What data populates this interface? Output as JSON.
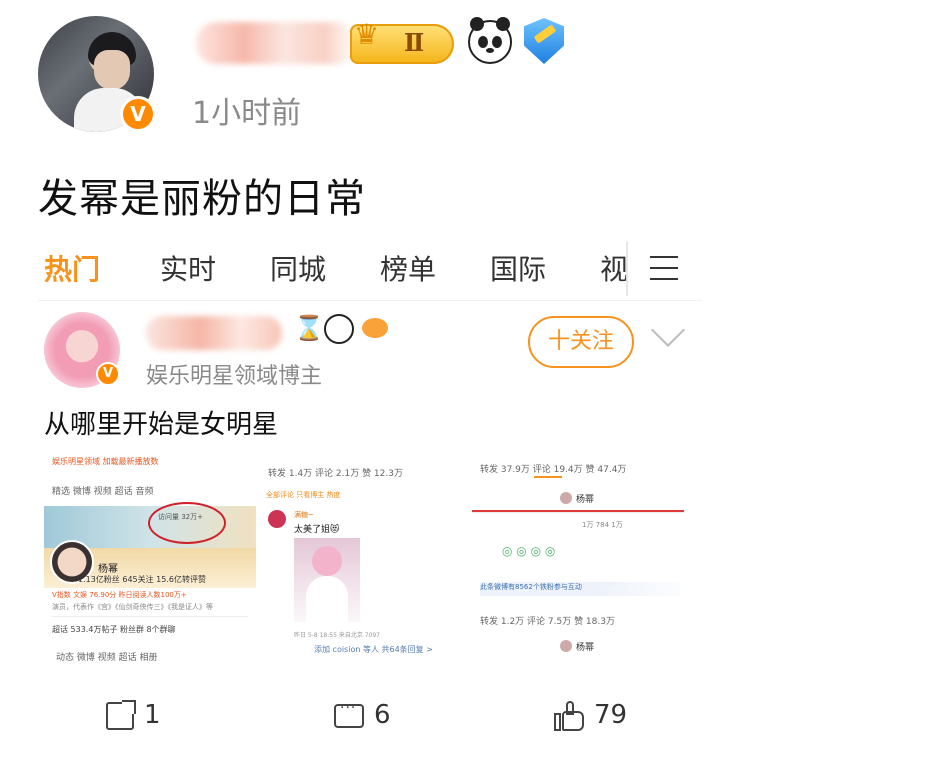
{
  "post": {
    "time": "1小时前",
    "text": "发幂是丽粉的日常",
    "crown_level": "Ⅱ"
  },
  "embed": {
    "tabs": [
      "热门",
      "实时",
      "同城",
      "榜单",
      "国际",
      "视"
    ],
    "user_subtitle": "娱乐明星领域博主",
    "follow_label": "十关注",
    "post_text": "从哪里开始是女明星",
    "thumb1": {
      "header": "娱乐明星领域 加载最新播放数",
      "tabs": "精选   微博   视频   超话   音频",
      "views_label": "访问量 32万+",
      "name": "杨幂",
      "stats": "1.13亿粉丝  645关注  15.6亿转评赞",
      "info1": "V指数 文娱 76.90分   昨日阅读人数100万+",
      "info2": "演员，代表作《宫》《仙剑奇侠传三》《我是证人》等",
      "info3": "超话  533.4万帖子   粉丝群  8个群聊",
      "bottom": "动态    微博    视频    超话    相册"
    },
    "thumb2": {
      "header": "转发 1.4万   评论 2.1万            赞 12.3万",
      "sub": "全部评论   只看博主                   热度",
      "commenter": "满糖~",
      "comment": "太美了姐😻",
      "footer": "昨日 5-8  18:55  来自北京           7097",
      "more": "添加 coision 等人  共64条回复 >"
    },
    "thumb3": {
      "header": "转发 37.9万   评论 19.4万            赞 47.4万",
      "name": "杨幂",
      "row": "1万   784   1万",
      "icons": "◎      ◎      ◎      ◎",
      "notice": "此条微博有8562个铁粉参与互动",
      "header2": "转发 1.2万   评论 7.5万              赞 18.3万"
    }
  },
  "actions": {
    "repost_count": "1",
    "comment_count": "6",
    "like_count": "79"
  },
  "colors": {
    "accent": "#f7931e",
    "verified": "#ff8a00"
  }
}
